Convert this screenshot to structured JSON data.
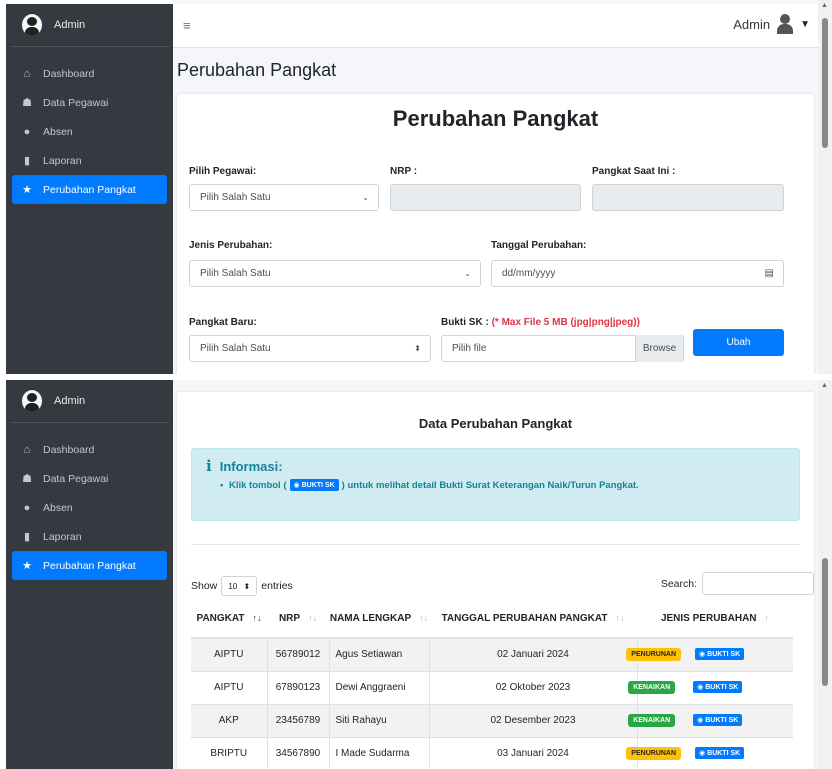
{
  "sidebar": {
    "brand": "Admin",
    "items": [
      {
        "label": "Dashboard",
        "icon": "home-icon"
      },
      {
        "label": "Data Pegawai",
        "icon": "users-icon"
      },
      {
        "label": "Absen",
        "icon": "stopwatch-icon"
      },
      {
        "label": "Laporan",
        "icon": "file-icon"
      },
      {
        "label": "Perubahan Pangkat",
        "icon": "star-icon",
        "active": true
      }
    ]
  },
  "topbar": {
    "user": "Admin"
  },
  "page": {
    "title": "Perubahan Pangkat"
  },
  "form": {
    "heading": "Perubahan Pangkat",
    "pilih_pegawai_label": "Pilih Pegawai:",
    "pilih_pegawai_value": "Pilih Salah Satu",
    "nrp_label": "NRP :",
    "pangkat_saat_ini_label": "Pangkat Saat Ini :",
    "jenis_perubahan_label": "Jenis Perubahan:",
    "jenis_perubahan_value": "Pilih Salah Satu",
    "tanggal_label": "Tanggal Perubahan:",
    "tanggal_placeholder": "dd/mm/yyyy",
    "pangkat_baru_label": "Pangkat Baru:",
    "pangkat_baru_value": "Pilih Salah Satu",
    "bukti_label": "Bukti SK :",
    "bukti_note": "(* Max File 5 MB (jpg|png|jpeg))",
    "file_placeholder": "Pilih file",
    "browse_label": "Browse",
    "submit_label": "Ubah"
  },
  "data_section": {
    "title": "Data Perubahan Pangkat",
    "info_title": "Informasi:",
    "info_prefix": "Klik tombol (",
    "info_button": "BUKTI SK",
    "info_suffix": ") untuk melihat detail Bukti Surat Keterangan Naik/Turun Pangkat.",
    "show_label": "Show",
    "entries_value": "10",
    "entries_label": "entries",
    "search_label": "Search:",
    "columns": [
      "PANGKAT",
      "NRP",
      "NAMA LENGKAP",
      "TANGGAL PERUBAHAN PANGKAT",
      "JENIS PERUBAHAN"
    ],
    "rows": [
      {
        "pangkat": "AIPTU",
        "nrp": "56789012",
        "nama": "Agus Setiawan",
        "tanggal": "02 Januari 2024",
        "jenis": "PENURUNAN",
        "type": "down",
        "bukti": "BUKTI SK"
      },
      {
        "pangkat": "AIPTU",
        "nrp": "67890123",
        "nama": "Dewi Anggraeni",
        "tanggal": "02 Oktober 2023",
        "jenis": "KENAIKAN",
        "type": "up",
        "bukti": "BUKTI SK"
      },
      {
        "pangkat": "AKP",
        "nrp": "23456789",
        "nama": "Siti Rahayu",
        "tanggal": "02 Desember 2023",
        "jenis": "KENAIKAN",
        "type": "up",
        "bukti": "BUKTI SK"
      },
      {
        "pangkat": "BRIPTU",
        "nrp": "34567890",
        "nama": "I Made Sudarma",
        "tanggal": "03 Januari 2024",
        "jenis": "PENURUNAN",
        "type": "down",
        "bukti": "BUKTI SK"
      }
    ]
  },
  "colors": {
    "sidebar": "#343a40",
    "primary": "#007bff",
    "warning": "#ffc107",
    "success": "#28a745",
    "info_bg": "#d1ecf1"
  }
}
